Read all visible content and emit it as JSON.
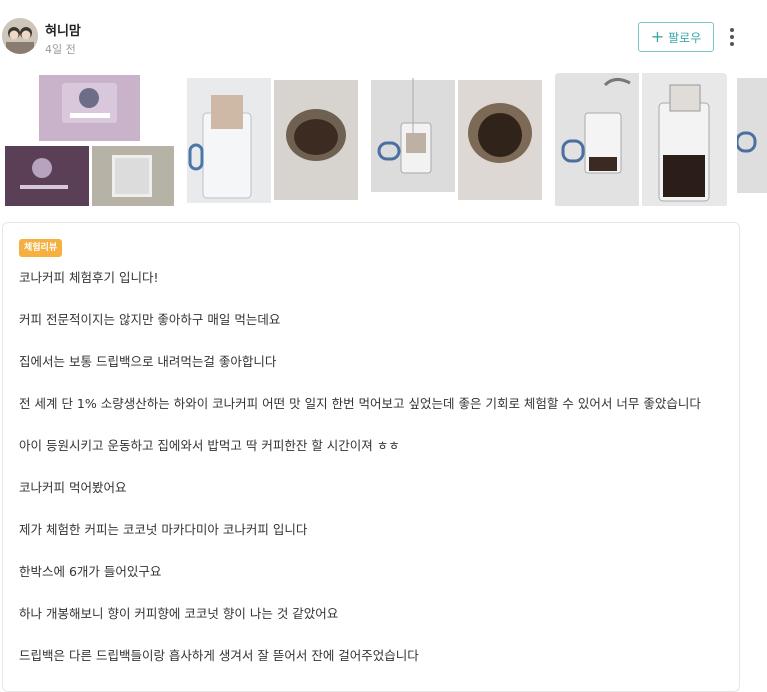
{
  "header": {
    "author": "혀니맘",
    "time": "4일 전",
    "follow_label": "팔로우",
    "follow_icon": "plus-icon",
    "more_icon": "more-vertical-icon"
  },
  "gallery": {
    "count": 5
  },
  "post": {
    "tag": "체험리뷰",
    "tag_color": "#f5b041",
    "paragraphs": [
      "코나커피 체험후기 입니다!",
      "커피 전문적이지는 않지만 좋아하구 매일 먹는데요",
      "집에서는 보통 드립백으로 내려먹는걸 좋아합니다",
      "전 세계 단 1% 소량생산하는 하와이 코나커피 어떤 맛 일지 한번 먹어보고 싶었는데 좋은 기회로 체험할 수 있어서 너무 좋았습니다",
      "아이 등원시키고 운동하고 집에와서 밥먹고 딱 커피한잔 할 시간이져 ㅎㅎ",
      "코나커피 먹어봤어요",
      "제가 체험한 커피는 코코넛 마카다미아 코나커피 입니다",
      "한박스에 6개가 들어있구요",
      "하나 개봉해보니 향이 커피향에 코코넛 향이 나는 것 같았어요",
      "드립백은 다른 드립백들이랑 흡사하게 생겨서 잘 뜯어서 잔에 걸어주었습니다"
    ]
  },
  "colors": {
    "accent": "#3aa7a7",
    "follow_border": "#7cc6c6"
  }
}
